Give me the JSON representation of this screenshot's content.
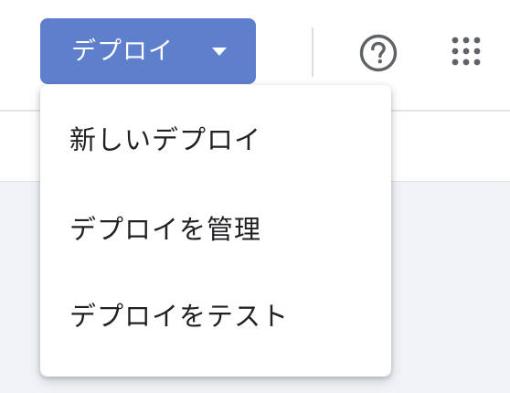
{
  "toolbar": {
    "deploy_label": "デプロイ",
    "icons": [
      "chevron-down-icon",
      "help-icon",
      "apps-grid-icon"
    ]
  },
  "deploy_menu": {
    "items": [
      {
        "label": "新しいデプロイ"
      },
      {
        "label": "デプロイを管理"
      },
      {
        "label": "デプロイをテスト"
      }
    ]
  },
  "colors": {
    "primary_button": "#5e7fcb",
    "icon_gray": "#5f6368",
    "menu_text": "#202124",
    "content_bg": "#f1f3f6"
  }
}
